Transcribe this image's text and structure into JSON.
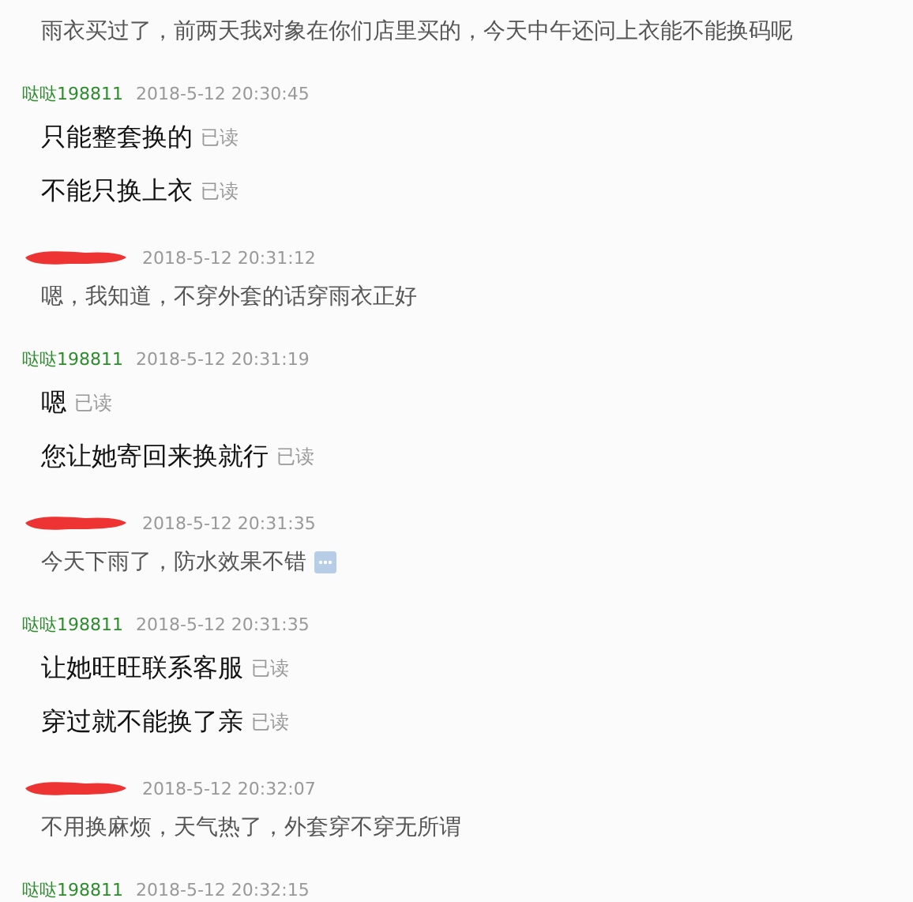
{
  "groups": [
    {
      "kind": "buyer",
      "messages": [
        {
          "text": "雨衣买过了，前两天我对象在你们店里买的，今天中午还问上衣能不能换码呢"
        }
      ]
    },
    {
      "kind": "seller",
      "name": "哒哒198811",
      "time": "2018-5-12 20:30:45",
      "messages": [
        {
          "text": "只能整套换的",
          "status": "已读"
        },
        {
          "text": "不能只换上衣",
          "status": "已读"
        }
      ]
    },
    {
      "kind": "buyer",
      "time": "2018-5-12 20:31:12",
      "messages": [
        {
          "text": "嗯，我知道，不穿外套的话穿雨衣正好"
        }
      ]
    },
    {
      "kind": "seller",
      "name": "哒哒198811",
      "time": "2018-5-12 20:31:19",
      "messages": [
        {
          "text": "嗯",
          "status": "已读"
        },
        {
          "text": "您让她寄回来换就行",
          "status": "已读"
        }
      ]
    },
    {
      "kind": "buyer",
      "time": "2018-5-12 20:31:35",
      "messages": [
        {
          "text": "今天下雨了，防水效果不错",
          "more": true
        }
      ]
    },
    {
      "kind": "seller",
      "name": "哒哒198811",
      "time": "2018-5-12 20:31:35",
      "messages": [
        {
          "text": "让她旺旺联系客服",
          "status": "已读"
        },
        {
          "text": "穿过就不能换了亲",
          "status": "已读"
        }
      ]
    },
    {
      "kind": "buyer",
      "time": "2018-5-12 20:32:07",
      "messages": [
        {
          "text": "不用换麻烦，天气热了，外套穿不穿无所谓"
        }
      ]
    },
    {
      "kind": "seller",
      "name": "哒哒198811",
      "time": "2018-5-12 20:32:15"
    }
  ]
}
